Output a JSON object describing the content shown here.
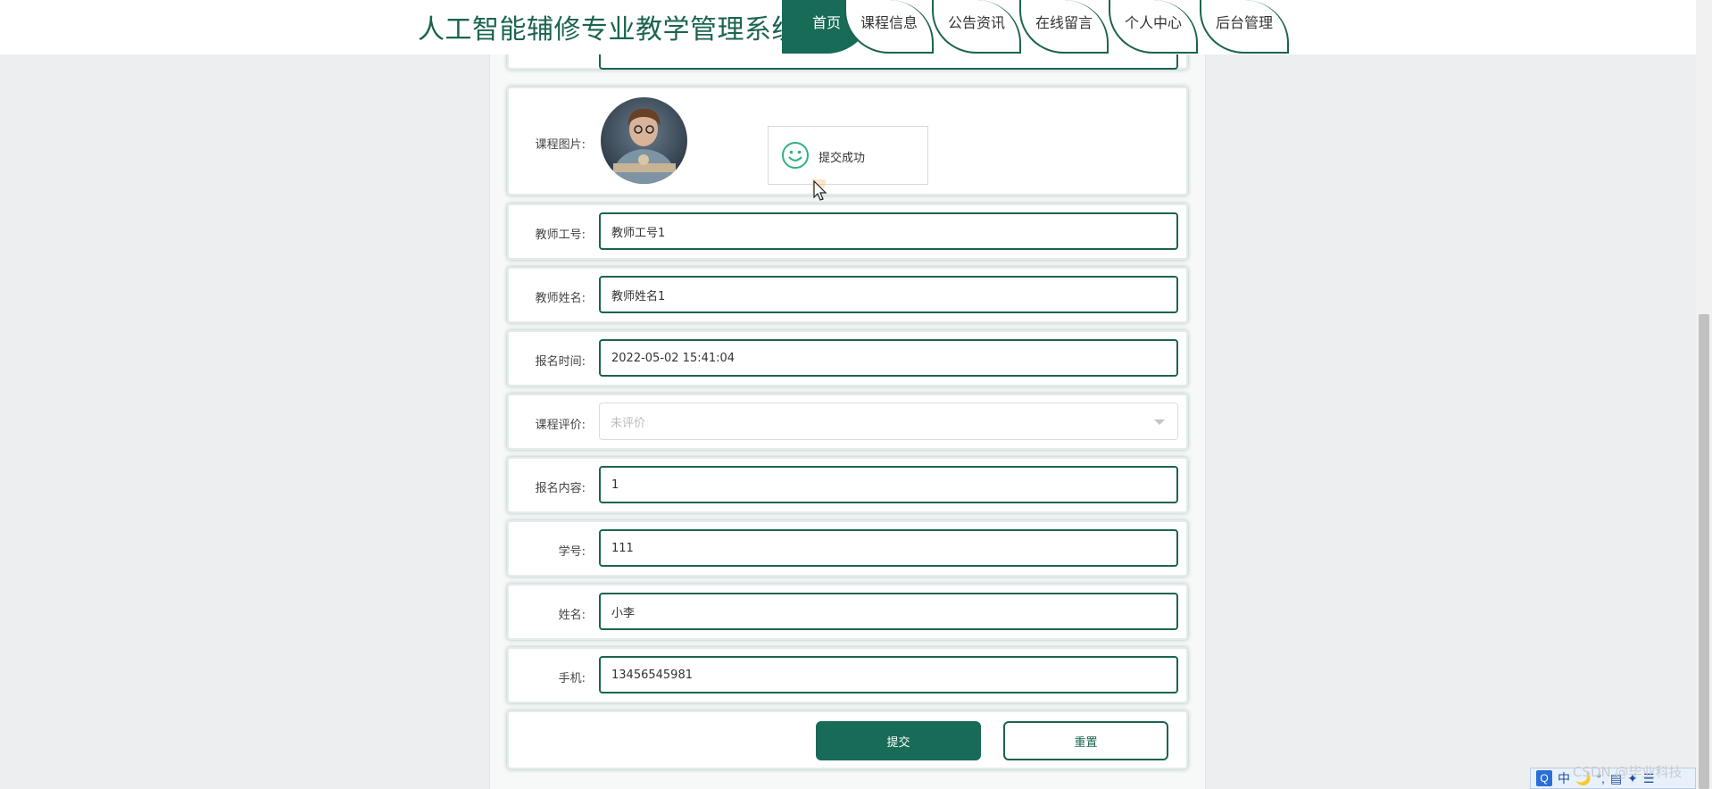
{
  "header": {
    "title": "人工智能辅修专业教学管理系统",
    "nav": [
      {
        "label": "首页",
        "active": true
      },
      {
        "label": "课程信息",
        "active": false
      },
      {
        "label": "公告资讯",
        "active": false
      },
      {
        "label": "在线留言",
        "active": false
      },
      {
        "label": "个人中心",
        "active": false
      },
      {
        "label": "后台管理",
        "active": false
      }
    ]
  },
  "form": {
    "course_image_label": "课程图片:",
    "teacher_id": {
      "label": "教师工号:",
      "value": "教师工号1"
    },
    "teacher_name": {
      "label": "教师姓名:",
      "value": "教师姓名1"
    },
    "signup_time": {
      "label": "报名时间:",
      "value": "2022-05-02 15:41:04"
    },
    "course_review": {
      "label": "课程评价:",
      "placeholder": "未评价"
    },
    "signup_content": {
      "label": "报名内容:",
      "value": "1"
    },
    "student_no": {
      "label": "学号:",
      "value": "111"
    },
    "student_name": {
      "label": "姓名:",
      "value": "小李"
    },
    "phone": {
      "label": "手机:",
      "value": "13456545981"
    },
    "submit_label": "提交",
    "reset_label": "重置"
  },
  "toast": {
    "message": "提交成功",
    "icon": "smile-icon"
  },
  "overlay": {
    "watermark": "CSDN @毕业科技",
    "ime": [
      "中",
      "🌙",
      "°,",
      "▤",
      "✦",
      "☰"
    ]
  },
  "colors": {
    "primary": "#176b57",
    "accent": "#1c6450",
    "background": "#edeeef"
  }
}
